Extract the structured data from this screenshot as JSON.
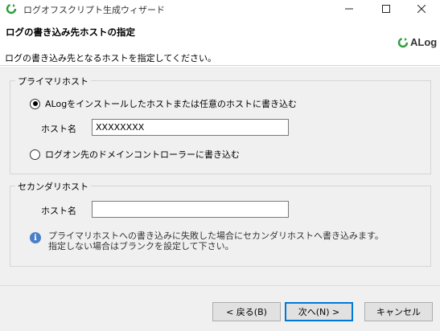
{
  "window": {
    "title": "ログオフスクリプト生成ウィザード",
    "minimize_icon": "minimize-icon",
    "maximize_icon": "maximize-icon",
    "close_icon": "close-icon"
  },
  "header": {
    "title": "ログの書き込み先ホストの指定",
    "description": "ログの書き込み先となるホストを指定してください。",
    "logo_text": "ALog"
  },
  "primary_group": {
    "title": "プライマリホスト",
    "option_install": {
      "label_brand": "ALog",
      "label_rest": "をインストールしたホストまたは任意のホストに書き込む",
      "checked": true
    },
    "host_label": "ホスト名",
    "host_value": "XXXXXXXX",
    "option_domain": {
      "label": "ログオン先のドメインコントローラーに書き込む",
      "checked": false
    }
  },
  "secondary_group": {
    "title": "セカンダリホスト",
    "host_label": "ホスト名",
    "host_value": "",
    "info_line1": "プライマリホストへの書き込みに失敗した場合にセカンダリホストへ書き込みます。",
    "info_line2": "指定しない場合はブランクを設定して下さい。"
  },
  "buttons": {
    "back": "< 戻る(B)",
    "next": "次へ(N) >",
    "cancel": "キャンセル"
  },
  "colors": {
    "accent": "#0078d7",
    "info": "#4a7fc8",
    "logo_green": "#2e9e3e"
  }
}
